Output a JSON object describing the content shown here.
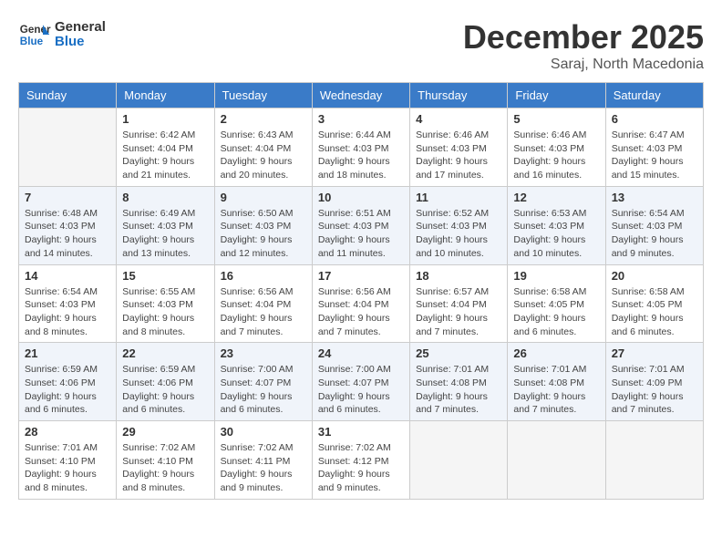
{
  "header": {
    "logo_line1": "General",
    "logo_line2": "Blue",
    "month": "December 2025",
    "location": "Saraj, North Macedonia"
  },
  "weekdays": [
    "Sunday",
    "Monday",
    "Tuesday",
    "Wednesday",
    "Thursday",
    "Friday",
    "Saturday"
  ],
  "weeks": [
    [
      {
        "day": "",
        "empty": true
      },
      {
        "day": "1",
        "sunrise": "6:42 AM",
        "sunset": "4:04 PM",
        "daylight": "9 hours and 21 minutes."
      },
      {
        "day": "2",
        "sunrise": "6:43 AM",
        "sunset": "4:04 PM",
        "daylight": "9 hours and 20 minutes."
      },
      {
        "day": "3",
        "sunrise": "6:44 AM",
        "sunset": "4:03 PM",
        "daylight": "9 hours and 18 minutes."
      },
      {
        "day": "4",
        "sunrise": "6:46 AM",
        "sunset": "4:03 PM",
        "daylight": "9 hours and 17 minutes."
      },
      {
        "day": "5",
        "sunrise": "6:46 AM",
        "sunset": "4:03 PM",
        "daylight": "9 hours and 16 minutes."
      },
      {
        "day": "6",
        "sunrise": "6:47 AM",
        "sunset": "4:03 PM",
        "daylight": "9 hours and 15 minutes."
      }
    ],
    [
      {
        "day": "7",
        "sunrise": "6:48 AM",
        "sunset": "4:03 PM",
        "daylight": "9 hours and 14 minutes."
      },
      {
        "day": "8",
        "sunrise": "6:49 AM",
        "sunset": "4:03 PM",
        "daylight": "9 hours and 13 minutes."
      },
      {
        "day": "9",
        "sunrise": "6:50 AM",
        "sunset": "4:03 PM",
        "daylight": "9 hours and 12 minutes."
      },
      {
        "day": "10",
        "sunrise": "6:51 AM",
        "sunset": "4:03 PM",
        "daylight": "9 hours and 11 minutes."
      },
      {
        "day": "11",
        "sunrise": "6:52 AM",
        "sunset": "4:03 PM",
        "daylight": "9 hours and 10 minutes."
      },
      {
        "day": "12",
        "sunrise": "6:53 AM",
        "sunset": "4:03 PM",
        "daylight": "9 hours and 10 minutes."
      },
      {
        "day": "13",
        "sunrise": "6:54 AM",
        "sunset": "4:03 PM",
        "daylight": "9 hours and 9 minutes."
      }
    ],
    [
      {
        "day": "14",
        "sunrise": "6:54 AM",
        "sunset": "4:03 PM",
        "daylight": "9 hours and 8 minutes."
      },
      {
        "day": "15",
        "sunrise": "6:55 AM",
        "sunset": "4:03 PM",
        "daylight": "9 hours and 8 minutes."
      },
      {
        "day": "16",
        "sunrise": "6:56 AM",
        "sunset": "4:04 PM",
        "daylight": "9 hours and 7 minutes."
      },
      {
        "day": "17",
        "sunrise": "6:56 AM",
        "sunset": "4:04 PM",
        "daylight": "9 hours and 7 minutes."
      },
      {
        "day": "18",
        "sunrise": "6:57 AM",
        "sunset": "4:04 PM",
        "daylight": "9 hours and 7 minutes."
      },
      {
        "day": "19",
        "sunrise": "6:58 AM",
        "sunset": "4:05 PM",
        "daylight": "9 hours and 6 minutes."
      },
      {
        "day": "20",
        "sunrise": "6:58 AM",
        "sunset": "4:05 PM",
        "daylight": "9 hours and 6 minutes."
      }
    ],
    [
      {
        "day": "21",
        "sunrise": "6:59 AM",
        "sunset": "4:06 PM",
        "daylight": "9 hours and 6 minutes."
      },
      {
        "day": "22",
        "sunrise": "6:59 AM",
        "sunset": "4:06 PM",
        "daylight": "9 hours and 6 minutes."
      },
      {
        "day": "23",
        "sunrise": "7:00 AM",
        "sunset": "4:07 PM",
        "daylight": "9 hours and 6 minutes."
      },
      {
        "day": "24",
        "sunrise": "7:00 AM",
        "sunset": "4:07 PM",
        "daylight": "9 hours and 6 minutes."
      },
      {
        "day": "25",
        "sunrise": "7:01 AM",
        "sunset": "4:08 PM",
        "daylight": "9 hours and 7 minutes."
      },
      {
        "day": "26",
        "sunrise": "7:01 AM",
        "sunset": "4:08 PM",
        "daylight": "9 hours and 7 minutes."
      },
      {
        "day": "27",
        "sunrise": "7:01 AM",
        "sunset": "4:09 PM",
        "daylight": "9 hours and 7 minutes."
      }
    ],
    [
      {
        "day": "28",
        "sunrise": "7:01 AM",
        "sunset": "4:10 PM",
        "daylight": "9 hours and 8 minutes."
      },
      {
        "day": "29",
        "sunrise": "7:02 AM",
        "sunset": "4:10 PM",
        "daylight": "9 hours and 8 minutes."
      },
      {
        "day": "30",
        "sunrise": "7:02 AM",
        "sunset": "4:11 PM",
        "daylight": "9 hours and 9 minutes."
      },
      {
        "day": "31",
        "sunrise": "7:02 AM",
        "sunset": "4:12 PM",
        "daylight": "9 hours and 9 minutes."
      },
      {
        "day": "",
        "empty": true
      },
      {
        "day": "",
        "empty": true
      },
      {
        "day": "",
        "empty": true
      }
    ]
  ],
  "labels": {
    "sunrise": "Sunrise:",
    "sunset": "Sunset:",
    "daylight": "Daylight:"
  }
}
